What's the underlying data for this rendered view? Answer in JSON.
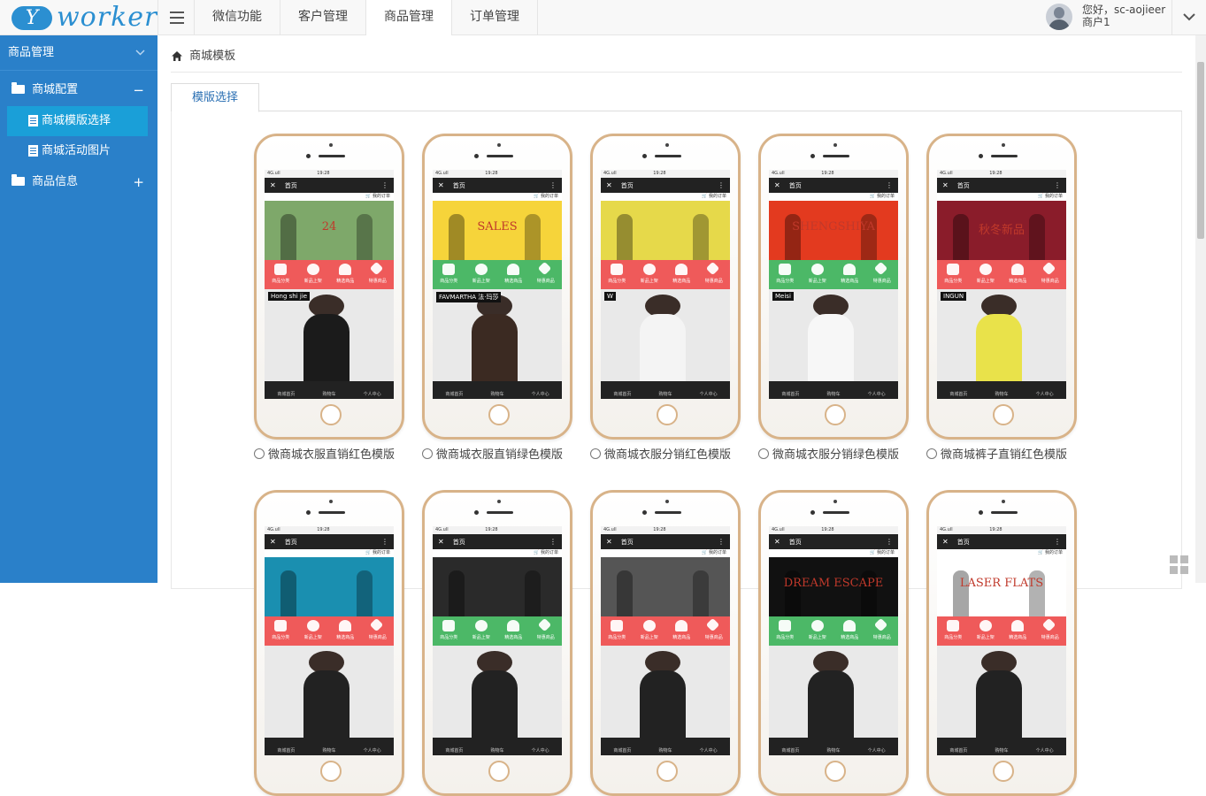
{
  "app": {
    "logo_letter": "Y",
    "logo_word": "worker"
  },
  "topnav": {
    "items": [
      "微信功能",
      "客户管理",
      "商品管理",
      "订单管理"
    ],
    "active_index": 2
  },
  "user": {
    "greeting": "您好，sc-aojieer",
    "role": "商户1"
  },
  "sidebar": {
    "header": "商品管理",
    "groups": [
      {
        "label": "商城配置",
        "toggle": "−",
        "items": [
          {
            "label": "商城模版选择",
            "active": true
          },
          {
            "label": "商城活动图片",
            "active": false
          }
        ]
      },
      {
        "label": "商品信息",
        "toggle": "+"
      }
    ]
  },
  "breadcrumb": {
    "label": "商城模板"
  },
  "tabs": {
    "active": "模版选择"
  },
  "phone_ui": {
    "status_left": "4G.ull",
    "time": "19:28",
    "title": "首页",
    "cart": "🛒 我的订单",
    "categories": [
      "商品分类",
      "新品上架",
      "精选商品",
      "特惠商品"
    ],
    "footer": [
      "商城首页",
      "购物车",
      "个人中心"
    ]
  },
  "templates": [
    {
      "label": "微商城衣服直销红色模版",
      "accent": "#ef5a5a",
      "banner": "#7ea86a",
      "brand": "Hong shi jie",
      "banner_text": "24",
      "dress": "#1b1b1b"
    },
    {
      "label": "微商城衣服直销绿色模版",
      "accent": "#4cb867",
      "banner": "#f6d43a",
      "brand": "FAVMARTHA 法·玛莎",
      "banner_text": "SALES",
      "dress": "#3b2a22"
    },
    {
      "label": "微商城衣服分销红色模版",
      "accent": "#ef5a5a",
      "banner": "#e6d94a",
      "brand": "W",
      "banner_text": "",
      "dress": "#f4f4f4"
    },
    {
      "label": "微商城衣服分销绿色模版",
      "accent": "#4cb867",
      "banner": "#e33a1f",
      "brand": "Meisi",
      "banner_text": "SHENGSHIYA",
      "dress": "#f7f7f7"
    },
    {
      "label": "微商城裤子直销红色模版",
      "accent": "#ef5a5a",
      "banner": "#8a1c2a",
      "brand": "INGUN",
      "banner_text": "秋冬新品",
      "dress": "#e9e24a"
    },
    {
      "label": "",
      "accent": "#ef5a5a",
      "banner": "#1a8fb0",
      "brand": "",
      "banner_text": "",
      "dress": "#222"
    },
    {
      "label": "",
      "accent": "#4cb867",
      "banner": "#2a2a2a",
      "brand": "",
      "banner_text": "",
      "dress": "#222"
    },
    {
      "label": "",
      "accent": "#ef5a5a",
      "banner": "#555555",
      "brand": "",
      "banner_text": "",
      "dress": "#222"
    },
    {
      "label": "",
      "accent": "#4cb867",
      "banner": "#111111",
      "brand": "",
      "banner_text": "DREAM ESCAPE",
      "dress": "#222"
    },
    {
      "label": "",
      "accent": "#ef5a5a",
      "banner": "#ffffff",
      "brand": "",
      "banner_text": "LASER FLATS",
      "dress": "#222"
    }
  ]
}
